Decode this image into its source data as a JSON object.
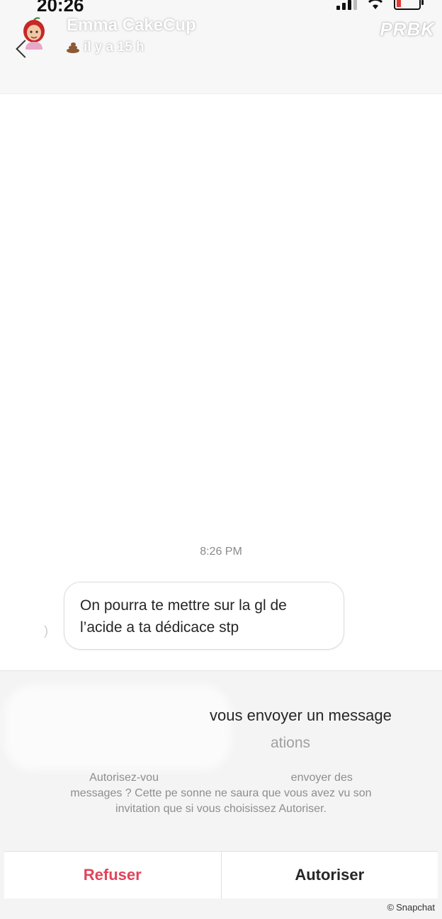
{
  "status_bar": {
    "time": "20:26"
  },
  "header": {
    "contact_name": "Emma CakeCup",
    "presence": "il y a 15 h",
    "watermark": "PRBK"
  },
  "conversation": {
    "timestamp": "8:26 PM",
    "messages": [
      {
        "line1": "On pourra te mettre sur la gl de",
        "line2": "l’acide a ta dédicace stp"
      }
    ],
    "side_mark": ")"
  },
  "request": {
    "title_fragment": "vous envoyer un message",
    "subtitle_fragment": "ations",
    "body_line1": "Autorisez-vou                                          envoyer des",
    "body_line2": "messages ? Cette pe sonne ne saura que vous avez vu son",
    "body_line3": "invitation que si vous choisissez Autoriser.",
    "refuse_label": "Refuser",
    "allow_label": "Autoriser"
  },
  "credit": {
    "symbol": "©",
    "text": "Snapchat"
  },
  "colors": {
    "refuse": "#e0445a",
    "battery_low": "#e53935"
  }
}
